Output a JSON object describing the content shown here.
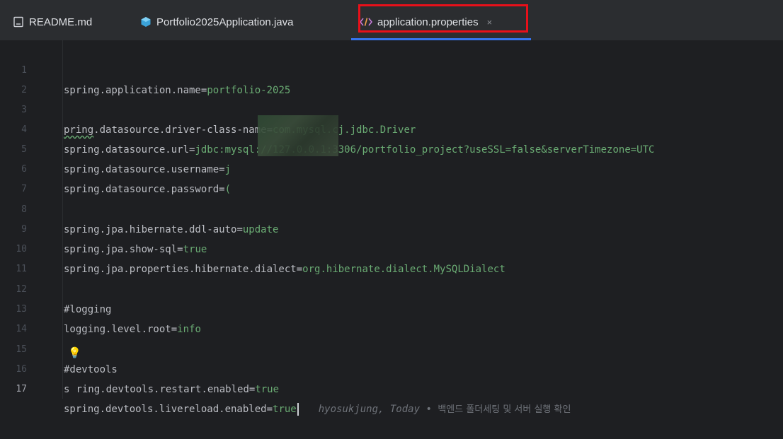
{
  "tabs": [
    {
      "label": "README.md",
      "icon": "document-icon"
    },
    {
      "label": "Portfolio2025Application.java",
      "icon": "java-class-icon"
    },
    {
      "label": "application.properties",
      "icon": "properties-file-icon",
      "active": true,
      "close": "×"
    }
  ],
  "lines": [
    {
      "num": "1",
      "key": "spring.application.name",
      "eq": "=",
      "val": "portfolio-2025"
    },
    {
      "num": "2"
    },
    {
      "num": "3",
      "key_typo": "pring",
      "key": ".datasource.driver-class-name",
      "eq": "=",
      "val": "com.mysql.cj.jdbc.Driver"
    },
    {
      "num": "4",
      "key": "spring.datasource.url",
      "eq": "=",
      "val": "jdbc:mysql://127.0.0.1:3306/portfolio_project?useSSL=false&serverTimezone=UTC"
    },
    {
      "num": "5",
      "key": "spring.datasource.username",
      "eq": "=",
      "val": "j"
    },
    {
      "num": "6",
      "key": "spring.datasource.password",
      "eq": "=",
      "val": "("
    },
    {
      "num": "7"
    },
    {
      "num": "8",
      "key": "spring.jpa.hibernate.ddl-auto",
      "eq": "=",
      "val": "update"
    },
    {
      "num": "9",
      "key": "spring.jpa.show-sql",
      "eq": "=",
      "val": "true"
    },
    {
      "num": "10",
      "key": "spring.jpa.properties.hibernate.dialect",
      "eq": "=",
      "val": "org.hibernate.dialect.MySQLDialect"
    },
    {
      "num": "11"
    },
    {
      "num": "12",
      "comment": "#logging"
    },
    {
      "num": "13",
      "key": "logging.level.root",
      "eq": "=",
      "val": "info"
    },
    {
      "num": "14"
    },
    {
      "num": "15",
      "comment": "#devtools"
    },
    {
      "num": "16",
      "key_pre": "s",
      "key": "ring.devtools.restart.enabled",
      "eq": "=",
      "val": "true"
    },
    {
      "num": "17",
      "key": "spring.devtools.livereload.enabled",
      "eq": "=",
      "val": "true"
    }
  ],
  "blame": {
    "author": "hyosukjung, Today",
    "separator": " • ",
    "message": "백엔드 폴더세팅 및 서버 실행 확인"
  },
  "colors": {
    "background": "#1e1f22",
    "value_green": "#6aab73",
    "active_tab_underline": "#3574f0",
    "highlight_box": "#e8101a"
  }
}
